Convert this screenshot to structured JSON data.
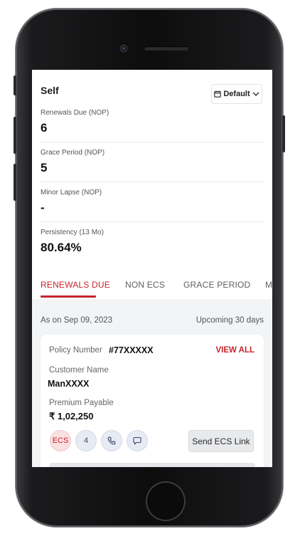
{
  "summary": {
    "title": "Self",
    "filter_label": "Default",
    "stats": [
      {
        "label": "Renewals Due (NOP)",
        "value": "6"
      },
      {
        "label": "Grace Period (NOP)",
        "value": "5"
      },
      {
        "label": "Minor Lapse (NOP)",
        "value": "-"
      },
      {
        "label": "Persistency (13 Mo)",
        "value": "80.64%"
      }
    ]
  },
  "tabs": [
    {
      "label": "RENEWALS DUE",
      "active": true
    },
    {
      "label": "NON ECS",
      "active": false
    },
    {
      "label": "GRACE PERIOD",
      "active": false
    },
    {
      "label": "M",
      "active": false
    }
  ],
  "list": {
    "as_on": "As on Sep 09, 2023",
    "range": "Upcoming 30 days"
  },
  "policy_card": {
    "policy_number_label": "Policy Number",
    "policy_number": "#77XXXXX",
    "view_all": "VIEW ALL",
    "customer_name_label": "Customer Name",
    "customer_name": "ManXXXX",
    "premium_label": "Premium Payable",
    "premium_value": "₹ 1,02,250",
    "ecs_chip": "ECS",
    "count_chip": "4",
    "send_button": "Send ECS Link"
  },
  "colors": {
    "accent": "#c6242c",
    "chip_bg": "#e7ebf3",
    "background": "#f3f4f6"
  },
  "icons": [
    "calendar-icon",
    "chevron-down-icon",
    "phone-icon",
    "message-icon"
  ]
}
